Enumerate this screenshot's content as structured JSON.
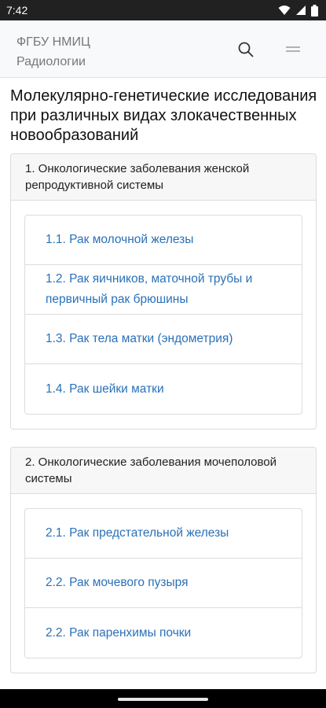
{
  "status_bar": {
    "time": "7:42",
    "icons": [
      "wifi-icon",
      "signal-icon",
      "battery-icon"
    ]
  },
  "header": {
    "brand_line1": "ФГБУ НМИЦ",
    "brand_line2": "Радиологии",
    "search_icon": "search-icon",
    "menu_icon": "menu-icon"
  },
  "page": {
    "title": "Молекулярно-генетические исследования при различных видах злокачественных новообразований"
  },
  "sections": [
    {
      "title": "1. Онкологические заболевания женской репродуктивной системы",
      "items": [
        "1.1. Рак молочной железы",
        "1.2. Рак яичников, маточной трубы и первичный рак брюшины",
        "1.3. Рак тела матки (эндометрия)",
        "1.4. Рак шейки матки"
      ]
    },
    {
      "title": "2. Онкологические заболевания мочеполовой системы",
      "items": [
        "2.1. Рак предстательной железы",
        "2.2. Рак мочевого пузыря",
        "2.2. Рак паренхимы почки"
      ]
    }
  ],
  "colors": {
    "status_bar": "#212121",
    "header_bg": "#f8f9fa",
    "link": "#2a70b8",
    "card_header_bg": "#f7f7f7",
    "border": "#dcdcdc"
  }
}
